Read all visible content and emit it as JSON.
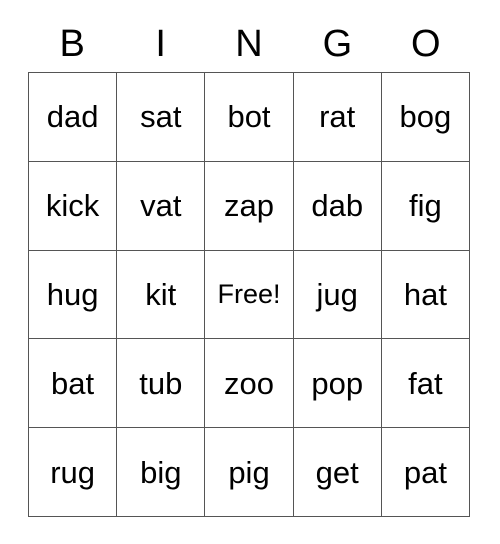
{
  "card": {
    "headers": [
      "B",
      "I",
      "N",
      "G",
      "O"
    ],
    "rows": [
      [
        "dad",
        "sat",
        "bot",
        "rat",
        "bog"
      ],
      [
        "kick",
        "vat",
        "zap",
        "dab",
        "fig"
      ],
      [
        "hug",
        "kit",
        "Free!",
        "jug",
        "hat"
      ],
      [
        "bat",
        "tub",
        "zoo",
        "pop",
        "fat"
      ],
      [
        "rug",
        "big",
        "pig",
        "get",
        "pat"
      ]
    ],
    "free_space": {
      "row": 2,
      "col": 2,
      "label": "Free!"
    },
    "colors": {
      "background": "#ffffff",
      "text": "#000000",
      "border": "#555555"
    }
  }
}
